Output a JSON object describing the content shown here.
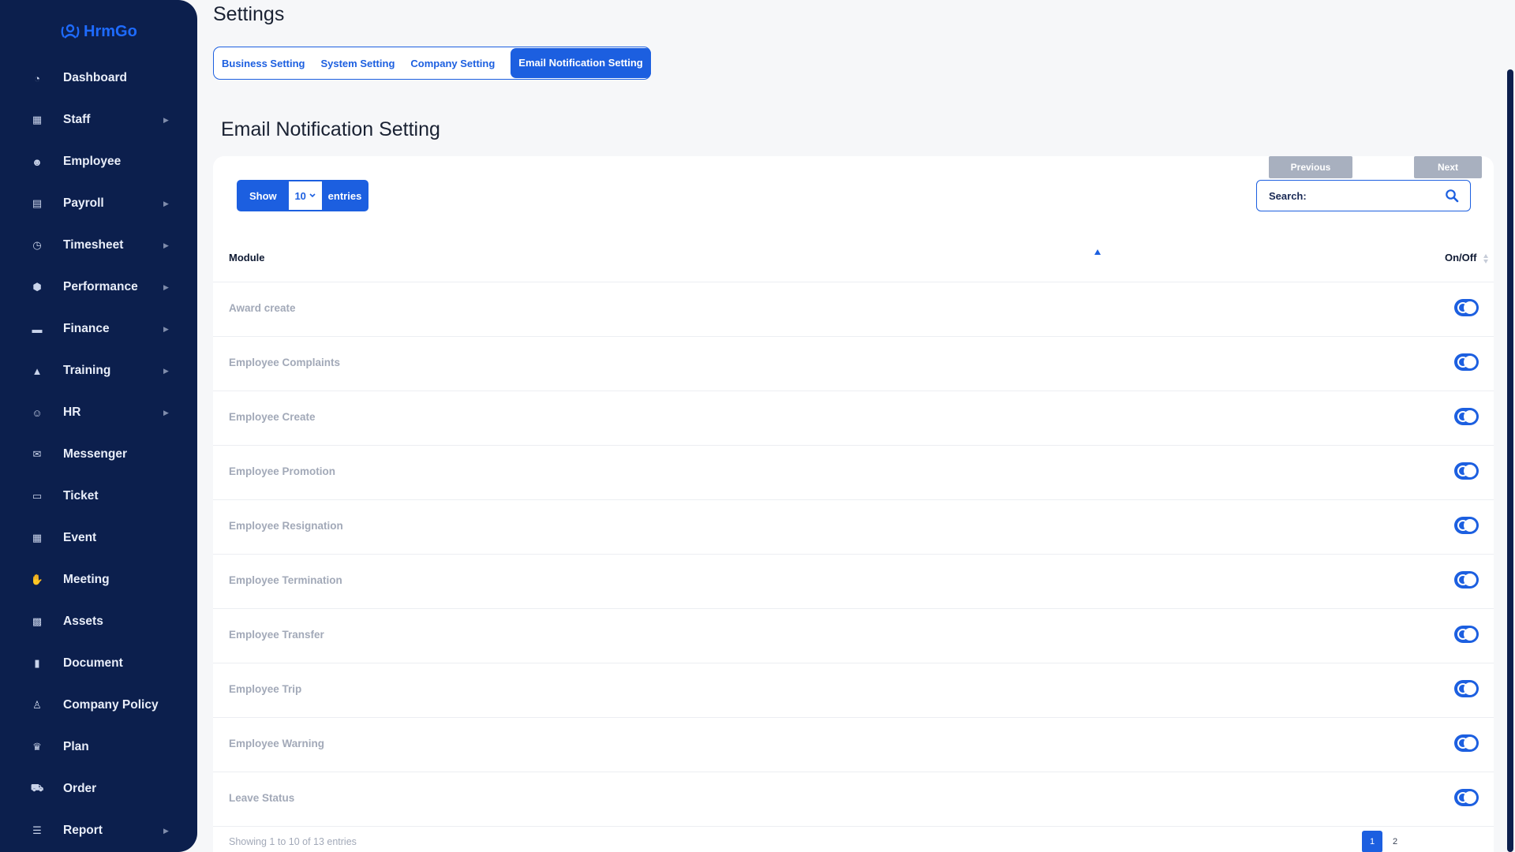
{
  "app": {
    "logo_text": "HrmGo"
  },
  "sidebar": {
    "items": [
      {
        "label": "Dashboard",
        "icon": "dashboard-icon",
        "glyph": "◔",
        "has_arrow": false
      },
      {
        "label": "Staff",
        "icon": "staff-icon",
        "glyph": "▦",
        "has_arrow": true
      },
      {
        "label": "Employee",
        "icon": "users-icon",
        "glyph": "☻",
        "has_arrow": false
      },
      {
        "label": "Payroll",
        "icon": "receipt-icon",
        "glyph": "▤",
        "has_arrow": true
      },
      {
        "label": "Timesheet",
        "icon": "clock-icon",
        "glyph": "◷",
        "has_arrow": true
      },
      {
        "label": "Performance",
        "icon": "cube-icon",
        "glyph": "⬢",
        "has_arrow": true
      },
      {
        "label": "Finance",
        "icon": "wallet-icon",
        "glyph": "▬",
        "has_arrow": true
      },
      {
        "label": "Training",
        "icon": "graduation-cap-icon",
        "glyph": "▲",
        "has_arrow": true
      },
      {
        "label": "HR",
        "icon": "user-cog-icon",
        "glyph": "☺",
        "has_arrow": true
      },
      {
        "label": "Messenger",
        "icon": "chat-icon",
        "glyph": "✉",
        "has_arrow": false
      },
      {
        "label": "Ticket",
        "icon": "ticket-icon",
        "glyph": "▭",
        "has_arrow": false
      },
      {
        "label": "Event",
        "icon": "calendar-icon",
        "glyph": "▦",
        "has_arrow": false
      },
      {
        "label": "Meeting",
        "icon": "handshake-icon",
        "glyph": "✋",
        "has_arrow": false
      },
      {
        "label": "Assets",
        "icon": "calculator-icon",
        "glyph": "▩",
        "has_arrow": false
      },
      {
        "label": "Document",
        "icon": "file-icon",
        "glyph": "▮",
        "has_arrow": false
      },
      {
        "label": "Company Policy",
        "icon": "policy-icon",
        "glyph": "♙",
        "has_arrow": false
      },
      {
        "label": "Plan",
        "icon": "trophy-icon",
        "glyph": "♛",
        "has_arrow": false
      },
      {
        "label": "Order",
        "icon": "cart-icon",
        "glyph": "⛟",
        "has_arrow": false
      },
      {
        "label": "Report",
        "icon": "list-icon",
        "glyph": "☰",
        "has_arrow": true
      }
    ]
  },
  "header": {
    "title": "Settings"
  },
  "tabs": [
    {
      "label": "Business Setting",
      "active": false
    },
    {
      "label": "System Setting",
      "active": false
    },
    {
      "label": "Company Setting",
      "active": false
    },
    {
      "label": "Email Notification Setting",
      "active": true
    }
  ],
  "section": {
    "title": "Email Notification Setting"
  },
  "table_controls": {
    "show_label": "Show",
    "length_value": "10",
    "entries_label": "entries",
    "search_label": "Search:"
  },
  "table": {
    "columns": [
      "Module",
      "On/Off"
    ],
    "rows": [
      {
        "module": "Award create",
        "on": true
      },
      {
        "module": "Employee Complaints",
        "on": true
      },
      {
        "module": "Employee Create",
        "on": true
      },
      {
        "module": "Employee Promotion",
        "on": true
      },
      {
        "module": "Employee Resignation",
        "on": true
      },
      {
        "module": "Employee Termination",
        "on": true
      },
      {
        "module": "Employee Transfer",
        "on": true
      },
      {
        "module": "Employee Trip",
        "on": true
      },
      {
        "module": "Employee Warning",
        "on": true
      },
      {
        "module": "Leave Status",
        "on": true
      }
    ]
  },
  "footer": {
    "info": "Showing 1 to 10 of 13 entries",
    "previous": "Previous",
    "pages": [
      "1",
      "2"
    ],
    "current_page": "1",
    "next": "Next"
  },
  "colors": {
    "sidebar_bg": "#0c1f4d",
    "accent": "#1c5fe0",
    "page_bg": "#f6f7f9"
  }
}
